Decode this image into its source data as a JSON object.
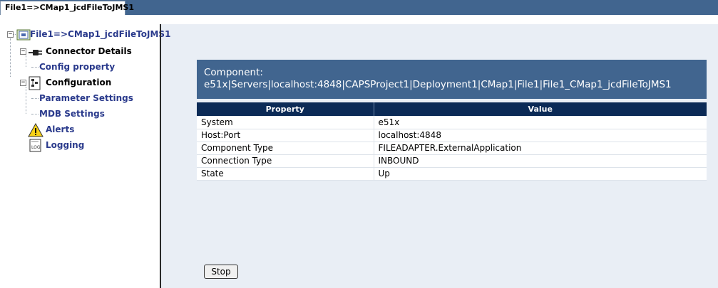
{
  "tab": {
    "label": "File1=>CMap1_jcdFileToJMS1"
  },
  "tree": {
    "root": {
      "label": "File1=>CMap1_jcdFileToJMS1",
      "icon": "component-icon"
    },
    "connector": {
      "label": "Connector Details",
      "icon": "connector-plug-icon"
    },
    "config_property": {
      "label": "Config property"
    },
    "configuration": {
      "label": "Configuration",
      "icon": "configuration-icon"
    },
    "parameter_settings": {
      "label": "Parameter Settings"
    },
    "mdb_settings": {
      "label": "MDB Settings"
    },
    "alerts": {
      "label": "Alerts",
      "icon": "warning-icon"
    },
    "logging": {
      "label": "Logging",
      "icon": "log-icon"
    }
  },
  "component": {
    "heading": "Component:",
    "path": "e51x|Servers|localhost:4848|CAPSProject1|Deployment1|CMap1|File1|File1_CMap1_jcdFileToJMS1"
  },
  "table": {
    "headers": [
      "Property",
      "Value"
    ],
    "rows": [
      [
        "System",
        "e51x"
      ],
      [
        "Host:Port",
        "localhost:4848"
      ],
      [
        "Component Type",
        "FILEADAPTER.ExternalApplication"
      ],
      [
        "Connection Type",
        "INBOUND"
      ],
      [
        "State",
        "Up"
      ]
    ]
  },
  "buttons": {
    "stop": "Stop"
  },
  "colors": {
    "header_bar": "#41658f",
    "table_header": "#0b2a56",
    "link_text": "#2a3a8c",
    "background": "#e9eef5"
  }
}
